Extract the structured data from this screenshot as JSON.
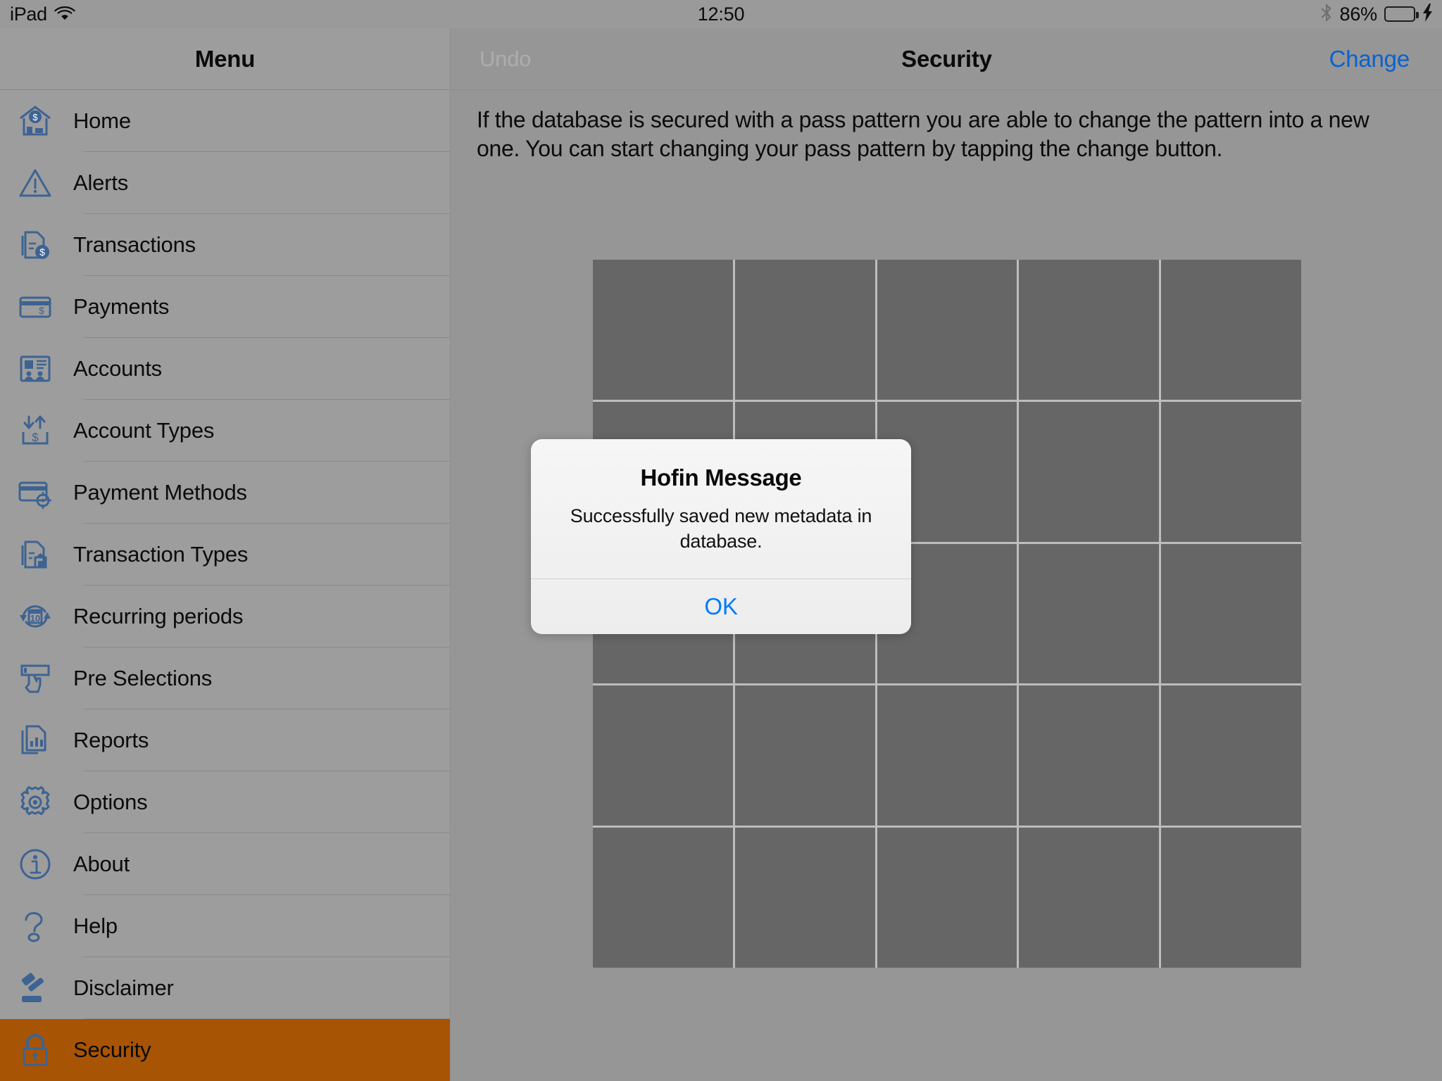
{
  "status_bar": {
    "device_label": "iPad",
    "wifi_icon": "wifi-icon",
    "clock": "12:50",
    "bluetooth_icon": "bluetooth-icon",
    "battery_percent": "86%",
    "battery_level": 86,
    "battery_fill_color": "#4cd75b",
    "charging_icon": "lightning-bolt-icon"
  },
  "sidebar": {
    "title": "Menu",
    "selected_index": 15,
    "selected_bg": "#a85405",
    "icon_color": "#3d6392",
    "items": [
      {
        "label": "Home",
        "icon": "house-dollar-icon"
      },
      {
        "label": "Alerts",
        "icon": "warning-triangle-icon"
      },
      {
        "label": "Transactions",
        "icon": "document-dollar-icon"
      },
      {
        "label": "Payments",
        "icon": "credit-card-dollar-icon"
      },
      {
        "label": "Accounts",
        "icon": "id-card-icon"
      },
      {
        "label": "Account Types",
        "icon": "arrows-dollar-icon"
      },
      {
        "label": "Payment Methods",
        "icon": "credit-card-gear-icon"
      },
      {
        "label": "Transaction Types",
        "icon": "document-house-icon"
      },
      {
        "label": "Recurring periods",
        "icon": "calendar-refresh-icon"
      },
      {
        "label": "Pre Selections",
        "icon": "hand-tap-icon"
      },
      {
        "label": "Reports",
        "icon": "document-chart-icon"
      },
      {
        "label": "Options",
        "icon": "gear-icon"
      },
      {
        "label": "About",
        "icon": "info-circle-icon"
      },
      {
        "label": "Help",
        "icon": "question-mark-icon"
      },
      {
        "label": "Disclaimer",
        "icon": "gavel-icon"
      },
      {
        "label": "Security",
        "icon": "padlock-icon"
      }
    ]
  },
  "navbar": {
    "undo_label": "Undo",
    "undo_enabled": false,
    "title": "Security",
    "change_label": "Change",
    "change_color": "#0a62d0"
  },
  "detail": {
    "info_text": "If the database is secured with a pass pattern you are able to change the pattern into a new one. You can start changing your pass pattern by tapping the change button.",
    "pattern_grid": {
      "rows": 5,
      "columns": 5,
      "cell_color": "#666666",
      "line_color": "#bdbdbd",
      "selected_cells": []
    }
  },
  "alert": {
    "title": "Hofin Message",
    "message": "Successfully saved new metadata in database.",
    "ok_label": "OK",
    "ok_color": "#007aff"
  }
}
